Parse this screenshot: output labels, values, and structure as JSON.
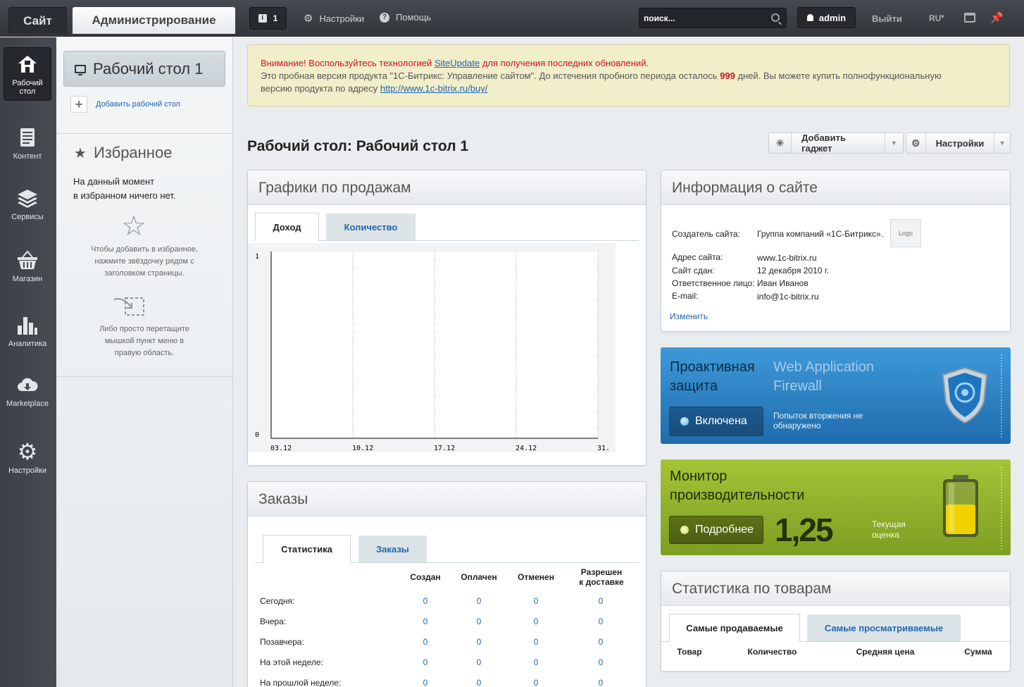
{
  "topbar": {
    "tab_site": "Сайт",
    "tab_admin": "Администрирование",
    "notifications_count": "1",
    "settings_label": "Настройки",
    "help_label": "Помощь",
    "search_placeholder": "поиск...",
    "user_name": "admin",
    "logout_label": "Выйти",
    "lang_label": "RU"
  },
  "leftnav": {
    "items": [
      {
        "label": "Рабочий стол",
        "icon": "home-icon",
        "active": true
      },
      {
        "label": "Контент",
        "icon": "document-icon",
        "active": false
      },
      {
        "label": "Сервисы",
        "icon": "layers-icon",
        "active": false
      },
      {
        "label": "Магазин",
        "icon": "basket-icon",
        "active": false
      },
      {
        "label": "Аналитика",
        "icon": "bar-chart-icon",
        "active": false
      },
      {
        "label": "Marketplace",
        "icon": "cloud-download-icon",
        "active": false
      },
      {
        "label": "Настройки",
        "icon": "gear-icon",
        "active": false
      }
    ]
  },
  "favorites": {
    "desktop_label": "Рабочий стол 1",
    "add_desktop_label": "Добавить рабочий стол",
    "title": "Избранное",
    "empty_line1": "На данный момент",
    "empty_line2": "в избранном ничего нет.",
    "hint1_l1": "Чтобы добавить в избранное,",
    "hint1_l2": "нажмите звёздочку рядом с",
    "hint1_l3": "заголовком страницы.",
    "hint2_l1": "Либо просто перетащите",
    "hint2_l2": "мышкой пункт меню в",
    "hint2_l3": "правую область."
  },
  "alert": {
    "line1_pre": "Внимание! Воспользуйтесь технологией ",
    "line1_link": "SiteUpdate",
    "line1_post": " для получения последних обновлений.",
    "line2_pre": "Это пробная версия продукта \"1С-Битрикс: Управление сайтом\". До истечения пробного периода осталось ",
    "days": "999",
    "line2_post": " дней. Вы можете купить полнофункциональную",
    "line3_pre": "версию продукта по адресу ",
    "line3_link": "http://www.1c-bitrix.ru/buy/"
  },
  "page": {
    "title": "Рабочий стол: Рабочий стол 1",
    "add_gadget_label": "Добавить гаджет",
    "settings_label": "Настройки"
  },
  "sales": {
    "title": "Графики по продажам",
    "tab_income": "Доход",
    "tab_quantity": "Количество"
  },
  "chart_data": {
    "type": "line",
    "categories": [
      "03.12",
      "10.12",
      "17.12",
      "24.12",
      "31."
    ],
    "series": [
      {
        "values": [
          0,
          0,
          0,
          0,
          0
        ]
      }
    ],
    "ylim": [
      0,
      1
    ],
    "yticks": [
      "1",
      "0"
    ],
    "grid": true
  },
  "orders": {
    "title": "Заказы",
    "tab_stats": "Статистика",
    "tab_orders": "Заказы",
    "columns": [
      "Создан",
      "Оплачен",
      "Отменен",
      "Разрешен к доставке"
    ],
    "col4_l1": "Разрешен",
    "col4_l2": "к доставке",
    "rows": [
      {
        "label": "Сегодня:",
        "values": [
          "0",
          "0",
          "0",
          "0"
        ]
      },
      {
        "label": "Вчера:",
        "values": [
          "0",
          "0",
          "0",
          "0"
        ]
      },
      {
        "label": "Позавчера:",
        "values": [
          "0",
          "0",
          "0",
          "0"
        ]
      },
      {
        "label": "На этой неделе:",
        "values": [
          "0",
          "0",
          "0",
          "0"
        ]
      },
      {
        "label": "На прошлой неделе:",
        "values": [
          "0",
          "0",
          "0",
          "0"
        ]
      }
    ]
  },
  "siteinfo": {
    "title": "Информация о сайте",
    "creator_label": "Создатель сайта:",
    "creator_value": "Группа компаний «1С-Битрикс».",
    "logo_label": "Logo",
    "address_label": "Адрес сайта:",
    "address_value": "www.1c-bitrix.ru",
    "date_label": "Сайт сдан:",
    "date_value": "12 декабря 2010 г.",
    "person_label": "Ответственное лицо:",
    "person_value": "Иван Иванов",
    "email_label": "E-mail:",
    "email_value": "info@1c-bitrix.ru",
    "edit_label": "Изменить"
  },
  "security": {
    "title_l1": "Проактивная",
    "title_l2": "защита",
    "subtitle_l1": "Web Application",
    "subtitle_l2": "Firewall",
    "status_label": "Включена",
    "note_l1": "Попыток вторжения не",
    "note_l2": "обнаружено"
  },
  "performance": {
    "title_l1": "Монитор",
    "title_l2": "производительности",
    "button_label": "Подробнее",
    "score": "1,25",
    "note_l1": "Текущая",
    "note_l2": "оценка"
  },
  "products": {
    "title": "Статистика по товарам",
    "tab_best": "Самые продаваемые",
    "tab_viewed": "Самые просматриваемые",
    "columns": [
      "Товар",
      "Количество",
      "Средняя цена",
      "Сумма"
    ]
  },
  "colors": {
    "accent_blue": "#2067b0",
    "security_blue": "#2a7fc4",
    "perf_green": "#90b22c",
    "alert_red": "#d0111b"
  }
}
